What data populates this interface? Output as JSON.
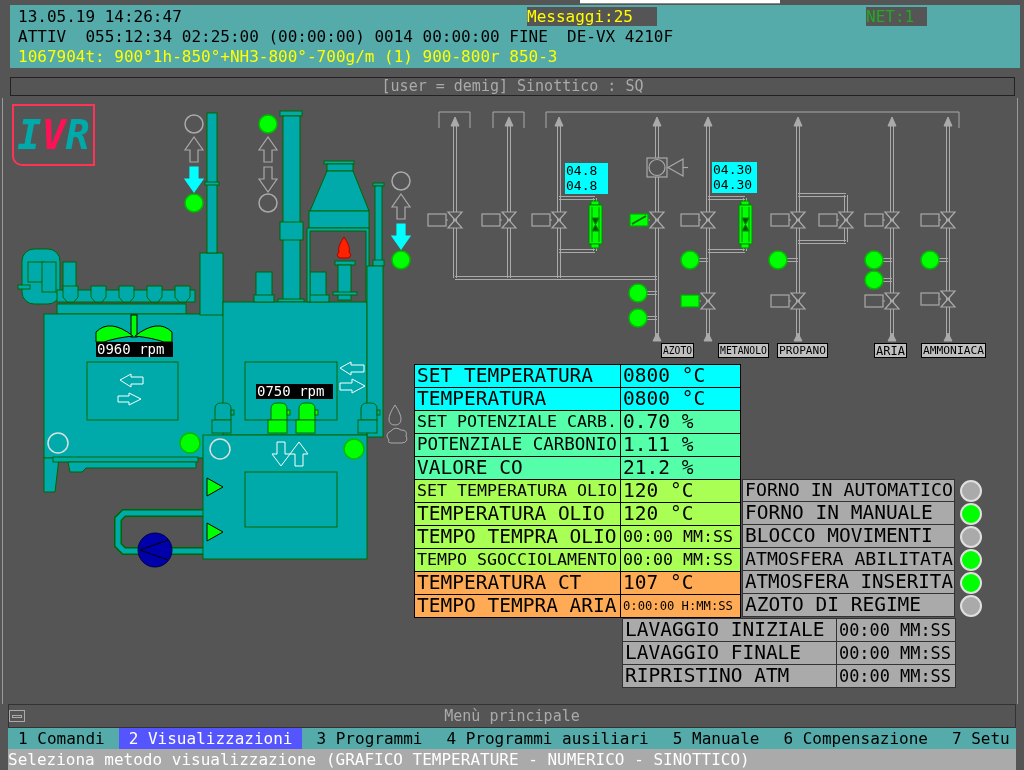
{
  "header": {
    "datetime": "13.05.19 14:26:47",
    "messages": "Messaggi:25",
    "network": "NET:1",
    "status_line": "ATTIV  055:12:34 02:25:00 (00:00:00) 0014 00:00:00 FINE  DE-VX 4210F",
    "recipe_line": "1067904t: 900°1h-850°+NH3-800°-700g/m (1) 900-800r 850-3"
  },
  "title_bar": {
    "title": "[user = demig] Sinottico : SQ"
  },
  "logo": {
    "text": "IVR"
  },
  "furnace": {
    "lifts": [
      {
        "top_lamp": false,
        "up_active": false,
        "down_active": true,
        "bottom_lamp": true
      },
      {
        "top_lamp": true,
        "up_active": false,
        "down_active": false,
        "bottom_lamp": false
      },
      {
        "top_lamp": false,
        "up_active": false,
        "down_active": true,
        "bottom_lamp": true
      }
    ],
    "burner_on": true,
    "agitator_on": true,
    "fan_speeds": [
      "0960 rpm",
      "0750 rpm"
    ],
    "lamps": [
      {
        "on": false
      },
      {
        "on": true
      },
      {
        "on": false
      },
      {
        "on": true
      }
    ],
    "motors": [
      {
        "on": false
      },
      {
        "on": true
      },
      {
        "on": true
      },
      {
        "on": false
      }
    ],
    "quench_jets": [
      {
        "on": true
      },
      {
        "on": true
      }
    ]
  },
  "gas_panel": {
    "lines": [
      {
        "actuators": [
          {
            "on": false
          }
        ]
      },
      {
        "actuators": [
          {
            "on": false
          }
        ]
      },
      {
        "flow": [
          "04.8",
          "04.8"
        ],
        "actuators": [
          {
            "on": false
          }
        ]
      },
      {
        "label": "AZOTO",
        "actuators": [
          {
            "on": true
          }
        ],
        "lamps": [
          {
            "on": true
          },
          {
            "on": true
          }
        ]
      },
      {
        "label": "METANOLO",
        "flow": [
          "04.30",
          "04.30"
        ],
        "actuators": [
          {
            "on": false
          },
          {
            "on": true
          }
        ],
        "lamps": [
          {
            "on": true
          }
        ]
      },
      {
        "label": "PROPANO",
        "actuators": [
          {
            "on": false
          },
          {
            "on": false
          },
          {
            "on": false
          }
        ],
        "lamps": [
          {
            "on": true
          }
        ]
      },
      {
        "label": "ARIA",
        "actuators": [
          {
            "on": false
          },
          {
            "on": false
          }
        ],
        "lamps": [
          {
            "on": true
          },
          {
            "on": true
          }
        ]
      },
      {
        "label": "AMMONIACA",
        "actuators": [
          {
            "on": false
          },
          {
            "on": false
          }
        ],
        "lamps": [
          {
            "on": true
          }
        ]
      }
    ]
  },
  "process_values": [
    {
      "label": "SET TEMPERATURA",
      "value": "0800 °C",
      "color": "#00ffff"
    },
    {
      "label": "TEMPERATURA",
      "value": "0800 °C",
      "color": "#00ffff"
    },
    {
      "label": "SET POTENZIALE CARB.",
      "value": "0.70 %",
      "color": "#55ffaa"
    },
    {
      "label": "POTENZIALE CARBONIO",
      "value": "1.11 %",
      "color": "#55ffaa"
    },
    {
      "label": "VALORE CO",
      "value": "21.2 %",
      "color": "#55ffaa"
    },
    {
      "label": "SET TEMPERATURA OLIO",
      "value": "120 °C",
      "color": "#aaff55"
    },
    {
      "label": "TEMPERATURA OLIO",
      "value": "120 °C",
      "color": "#aaff55"
    },
    {
      "label": "TEMPO TEMPRA OLIO",
      "value": "00:00 MM:SS",
      "color": "#aaff55"
    },
    {
      "label": "TEMPO SGOCCIOLAMENTO",
      "value": "00:00 MM:SS",
      "color": "#aaff55"
    },
    {
      "label": "TEMPERATURA CT",
      "value": "107 °C",
      "color": "#ffaa55"
    },
    {
      "label": "TEMPO TEMPRA ARIA",
      "value": "0:00:00 H:MM:SS",
      "color": "#ffaa55"
    }
  ],
  "status_lamps": [
    {
      "label": "FORNO IN AUTOMATICO",
      "on": false
    },
    {
      "label": "FORNO IN MANUALE",
      "on": true
    },
    {
      "label": "BLOCCO MOVIMENTI",
      "on": false
    },
    {
      "label": "ATMOSFERA ABILITATA",
      "on": true
    },
    {
      "label": "ATMOSFERA INSERITA",
      "on": true
    },
    {
      "label": "AZOTO DI REGIME",
      "on": false
    }
  ],
  "timers": [
    {
      "label": "LAVAGGIO INIZIALE",
      "value": "00:00 MM:SS"
    },
    {
      "label": "LAVAGGIO FINALE",
      "value": "00:00 MM:SS"
    },
    {
      "label": "RIPRISTINO ATM",
      "value": "00:00 MM:SS"
    }
  ],
  "menu": {
    "title": "Menù principale",
    "items": [
      {
        "label": "1 Comandi",
        "selected": false
      },
      {
        "label": "2 Visualizzazioni",
        "selected": true
      },
      {
        "label": "3 Programmi",
        "selected": false
      },
      {
        "label": "4 Programmi ausiliari",
        "selected": false
      },
      {
        "label": "5 Manuale",
        "selected": false
      },
      {
        "label": "6 Compensazione",
        "selected": false
      },
      {
        "label": "7 Setu",
        "selected": false
      }
    ],
    "hint": "Seleziona metodo visualizzazione (GRAFICO TEMPERATURE - NUMERICO - SINOTTICO)"
  }
}
